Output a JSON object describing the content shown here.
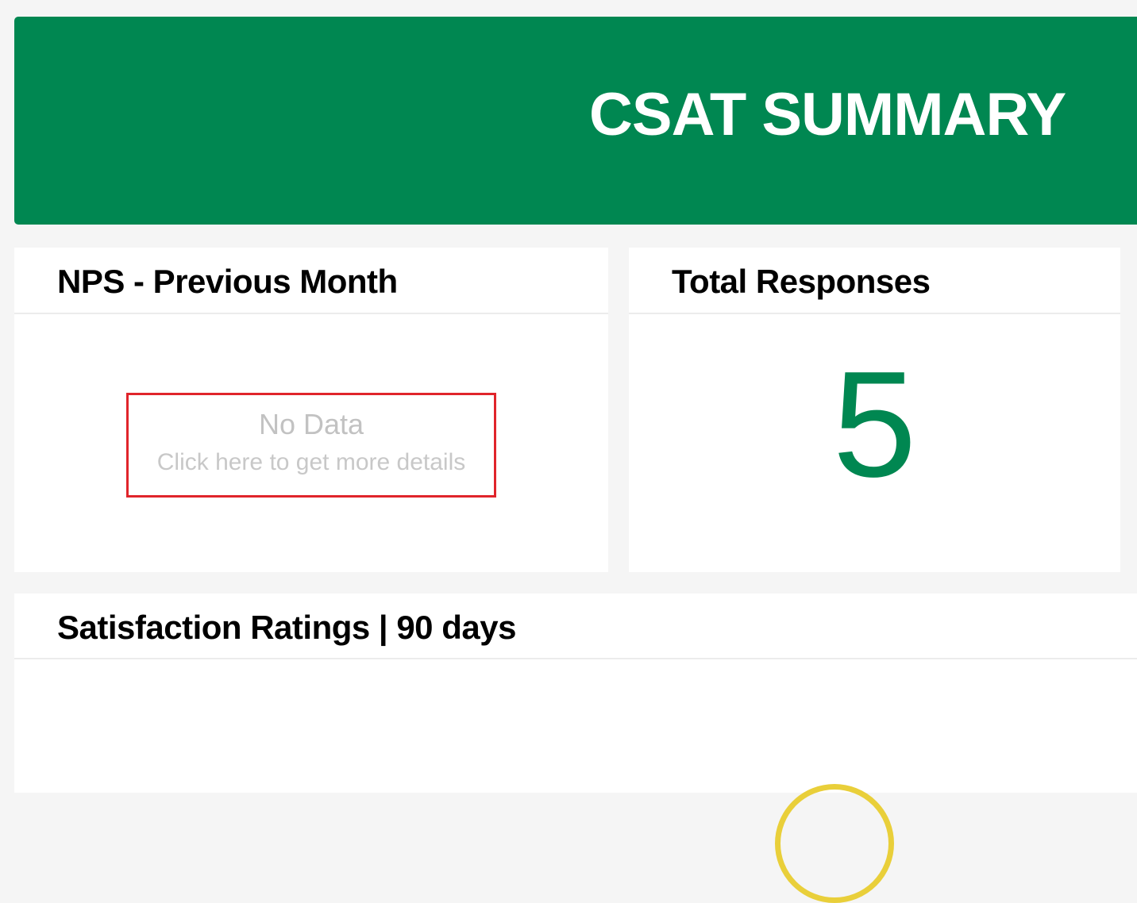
{
  "header": {
    "title": "CSAT SUMMARY",
    "background_color": "#008751"
  },
  "nps_card": {
    "title": "NPS - Previous Month",
    "no_data_title": "No Data",
    "no_data_subtitle": "Click here to get more details",
    "highlight_color": "#e0242b"
  },
  "total_responses_card": {
    "title": "Total Responses",
    "value": "5",
    "value_color": "#008751"
  },
  "satisfaction_card": {
    "title": "Satisfaction Ratings | 90 days",
    "gauge_color": "#e9cf3a"
  }
}
